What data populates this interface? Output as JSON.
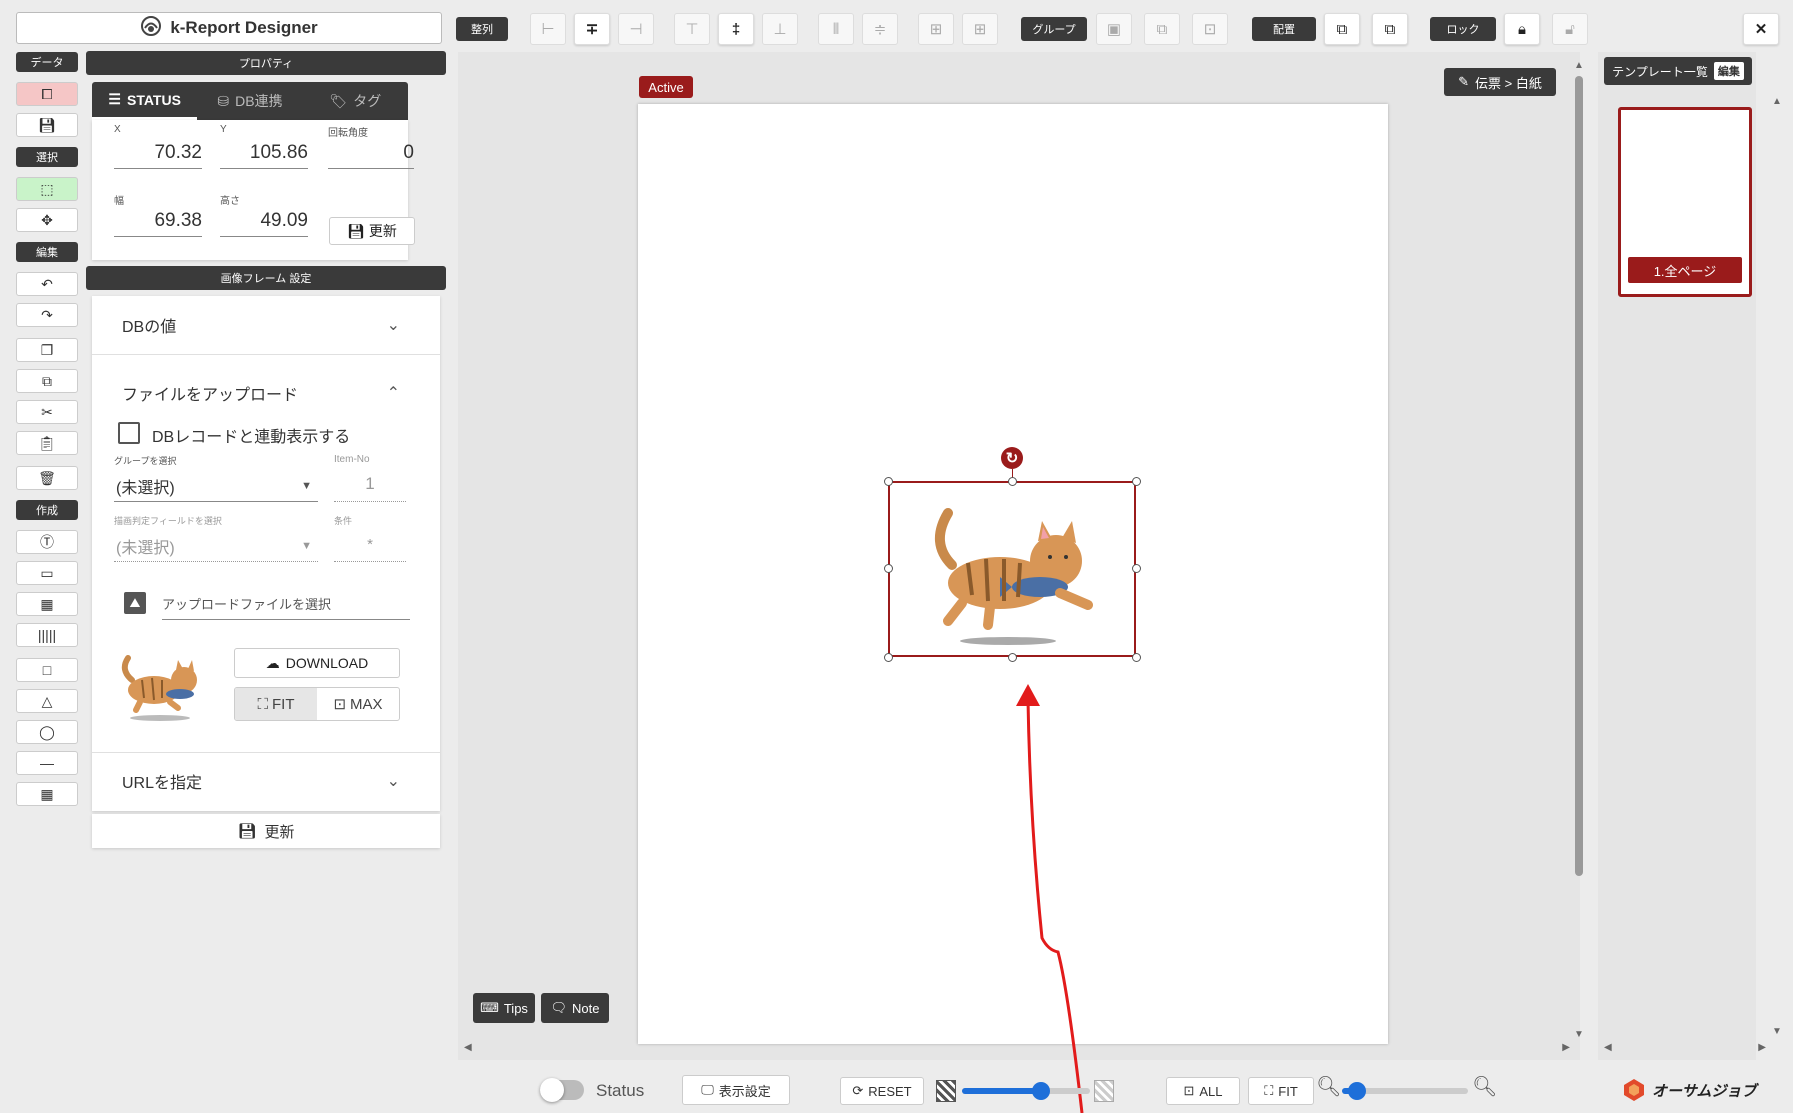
{
  "app": {
    "title": "k-Report Designer"
  },
  "toolbar": {
    "align_label": "整列",
    "group_label": "グループ",
    "arrange_label": "配置",
    "lock_label": "ロック",
    "close_icon": "close-icon"
  },
  "left_tools": {
    "data_label": "データ",
    "select_label": "選択",
    "edit_label": "編集",
    "create_label": "作成"
  },
  "properties": {
    "header": "プロパティ",
    "tabs": [
      {
        "label": "STATUS",
        "icon": "sliders-icon"
      },
      {
        "label": "DB連携",
        "icon": "database-icon"
      },
      {
        "label": "タグ",
        "icon": "tag-icon"
      }
    ],
    "x_label": "X",
    "x_value": "70.32",
    "y_label": "Y",
    "y_value": "105.86",
    "rotation_label": "回転角度",
    "rotation_value": "0",
    "width_label": "幅",
    "width_value": "69.38",
    "height_label": "高さ",
    "height_value": "49.09",
    "update_label": "更新"
  },
  "image_frame": {
    "header": "画像フレーム 設定",
    "db_value_label": "DBの値",
    "upload_label": "ファイルをアップロード",
    "db_link_checkbox_label": "DBレコードと連動表示する",
    "group_select_label": "グループを選択",
    "group_select_value": "(未選択)",
    "item_no_label": "Item-No",
    "item_no_value": "1",
    "field_select_label": "描画判定フィールドを選択",
    "field_select_value": "(未選択)",
    "condition_label": "条件",
    "condition_value": "*",
    "upload_file_placeholder": "アップロードファイルを選択",
    "download_label": "DOWNLOAD",
    "fit_label": "FIT",
    "max_label": "MAX",
    "url_label": "URLを指定",
    "update_label": "更新"
  },
  "canvas": {
    "active_badge": "Active",
    "breadcrumb": "伝票 > 白紙",
    "tips_label": "Tips",
    "note_label": "Note"
  },
  "templates": {
    "header": "テンプレート一覧",
    "edit_label": "編集",
    "page_label": "1.全ページ"
  },
  "bottom": {
    "status_label": "Status",
    "display_settings_label": "表示設定",
    "reset_label": "RESET",
    "all_label": "ALL",
    "fit_label": "FIT",
    "brand_label": "オーサムジョブ",
    "opacity_level": 0.62,
    "zoom_level": 0.12
  },
  "colors": {
    "accent": "#9a1b1b",
    "dark": "#3a3a3a"
  }
}
